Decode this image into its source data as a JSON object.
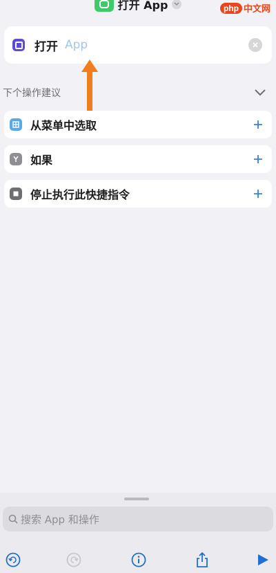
{
  "header": {
    "title": "打开 App"
  },
  "watermark": {
    "brand": "php",
    "site": "中文网"
  },
  "action": {
    "verb": "打开",
    "parameter_placeholder": "App",
    "icon": "app-square-icon",
    "accent_color": "#5b4bd6"
  },
  "suggestions": {
    "title": "下个操作建议",
    "items": [
      {
        "label": "从菜单中选取",
        "icon": "menu-grid-icon",
        "color": "#5aa9e6"
      },
      {
        "label": "如果",
        "icon": "branch-icon",
        "color": "#8e8e93"
      },
      {
        "label": "停止执行此快捷指令",
        "icon": "stop-square-icon",
        "color": "#6d6d72"
      }
    ]
  },
  "search": {
    "placeholder": "搜索 App 和操作"
  },
  "toolbar": {
    "buttons": [
      "undo-icon",
      "redo-icon",
      "info-icon",
      "share-icon",
      "play-icon"
    ],
    "accent_color": "#1f6fd0"
  }
}
